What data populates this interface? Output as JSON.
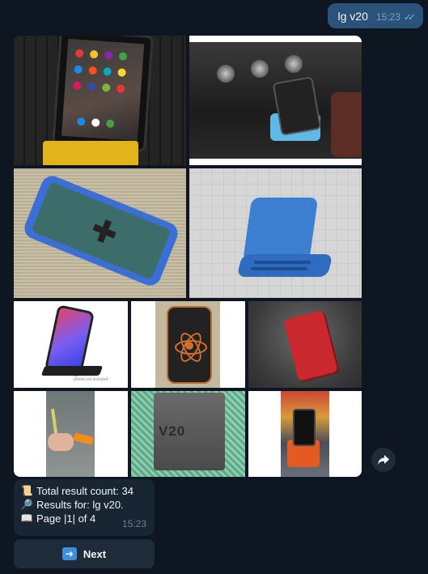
{
  "outgoing": {
    "text": "lg v20",
    "time": "15:23",
    "read_ticks": "✓✓"
  },
  "album": {
    "photo_count": 10,
    "photos": [
      {
        "subject": "phone on yellow dock"
      },
      {
        "subject": "phone in car console cradle"
      },
      {
        "subject": "blue phone case"
      },
      {
        "subject": "blue 3d render stand"
      },
      {
        "subject": "iphone on black stand",
        "caption": "phone not included"
      },
      {
        "subject": "black case with atom logo"
      },
      {
        "subject": "red case render"
      },
      {
        "subject": "orange printed part in hand"
      },
      {
        "subject": "grey V20 stand",
        "text": "V20"
      },
      {
        "subject": "phone on orange stand"
      }
    ]
  },
  "share_icon": "share-arrow-icon",
  "info": {
    "line1": "Total result count: 34",
    "line2": "Results for: lg v20.",
    "line3": "Page |1| of 4",
    "time": "15:23",
    "icons": [
      "scroll-icon",
      "magnifier-icon",
      "book-icon"
    ]
  },
  "next_button": {
    "label": "Next",
    "icon": "arrow-right-icon"
  },
  "colors": {
    "background": "#0e1621",
    "outgoing_bubble": "#2b5278",
    "incoming_bubble": "#182533",
    "button": "#1e2c3a",
    "ticks": "#64b5f6"
  }
}
